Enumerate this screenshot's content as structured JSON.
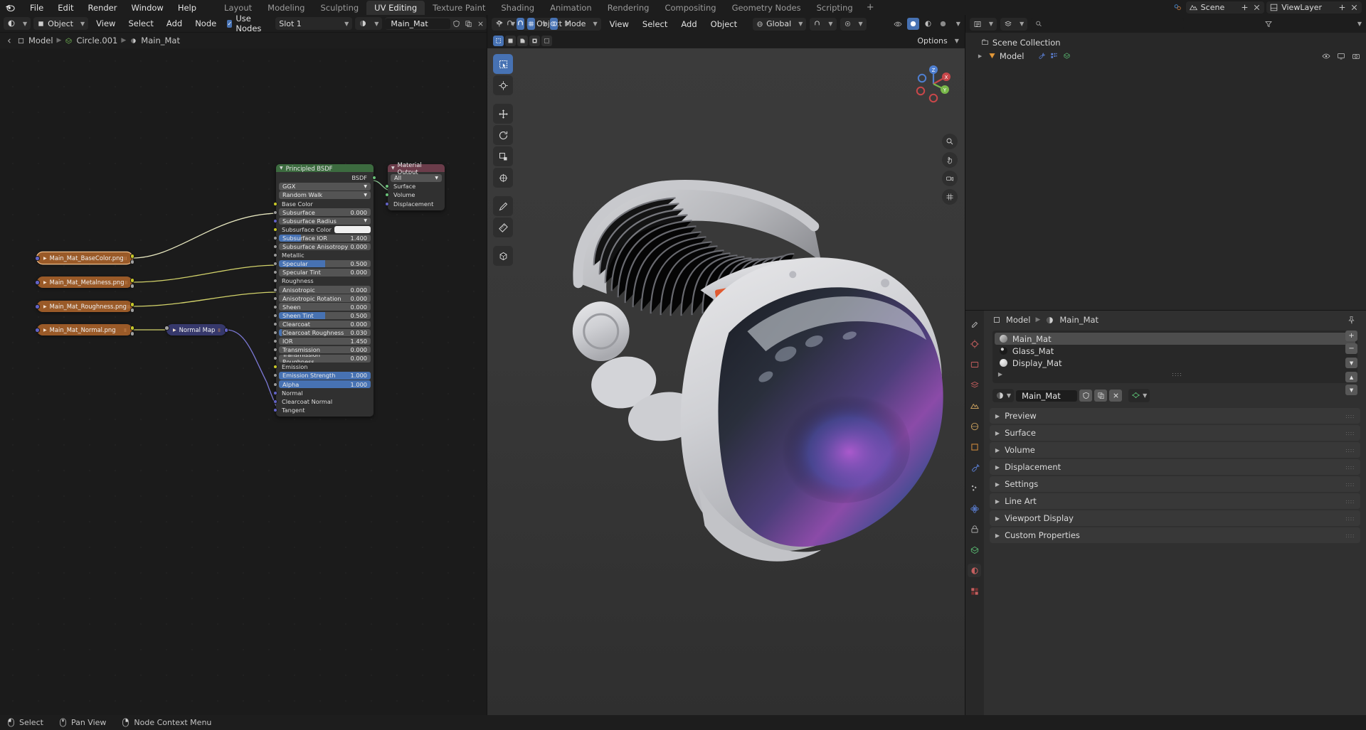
{
  "topbar": {
    "logo": "blender-logo",
    "menus": [
      "File",
      "Edit",
      "Render",
      "Window",
      "Help"
    ],
    "workspaces": [
      {
        "label": "Layout",
        "active": false
      },
      {
        "label": "Modeling",
        "active": false
      },
      {
        "label": "Sculpting",
        "active": false
      },
      {
        "label": "UV Editing",
        "active": true
      },
      {
        "label": "Texture Paint",
        "active": false
      },
      {
        "label": "Shading",
        "active": false
      },
      {
        "label": "Animation",
        "active": false
      },
      {
        "label": "Rendering",
        "active": false
      },
      {
        "label": "Compositing",
        "active": false
      },
      {
        "label": "Geometry Nodes",
        "active": false
      },
      {
        "label": "Scripting",
        "active": false
      }
    ],
    "add_workspace": "+",
    "scene_label": "Scene",
    "viewlayer_label": "ViewLayer"
  },
  "shader_editor": {
    "header": {
      "editor_type": "shader-editor-icon",
      "shader_type": "Object",
      "menus": [
        "View",
        "Select",
        "Add",
        "Node"
      ],
      "use_nodes_label": "Use Nodes",
      "use_nodes_checked": true,
      "slot": "Slot 1",
      "material": "Main_Mat"
    },
    "breadcrumb": [
      "Model",
      "Circle.001",
      "Main_Mat"
    ],
    "nodes": {
      "principled": {
        "title": "Principled BSDF",
        "header_color": "#3c6b3f",
        "output_socket": "BSDF",
        "distribution": "GGX",
        "subsurface_method": "Random Walk",
        "inputs": [
          {
            "label": "Base Color",
            "type": "socket",
            "sock": "yellow"
          },
          {
            "label": "Subsurface",
            "value": "0.000",
            "type": "slider",
            "fill": 0,
            "sock": "gray"
          },
          {
            "label": "Subsurface Radius",
            "type": "dropdown",
            "sock": "purple"
          },
          {
            "label": "Subsurface Color",
            "type": "color",
            "swatch": "#f0f0f0",
            "sock": "yellow"
          },
          {
            "label": "Subsurface IOR",
            "value": "1.400",
            "type": "slider",
            "fill": 24,
            "sock": "gray"
          },
          {
            "label": "Subsurface Anisotropy",
            "value": "0.000",
            "type": "slider",
            "fill": 0,
            "sock": "gray"
          },
          {
            "label": "Metallic",
            "type": "socket",
            "sock": "gray"
          },
          {
            "label": "Specular",
            "value": "0.500",
            "type": "slider",
            "fill": 50,
            "sock": "gray"
          },
          {
            "label": "Specular Tint",
            "value": "0.000",
            "type": "slider",
            "fill": 0,
            "sock": "gray"
          },
          {
            "label": "Roughness",
            "type": "socket",
            "sock": "gray"
          },
          {
            "label": "Anisotropic",
            "value": "0.000",
            "type": "slider",
            "fill": 0,
            "sock": "gray"
          },
          {
            "label": "Anisotropic Rotation",
            "value": "0.000",
            "type": "slider",
            "fill": 0,
            "sock": "gray"
          },
          {
            "label": "Sheen",
            "value": "0.000",
            "type": "slider",
            "fill": 0,
            "sock": "gray"
          },
          {
            "label": "Sheen Tint",
            "value": "0.500",
            "type": "slider",
            "fill": 50,
            "sock": "gray"
          },
          {
            "label": "Clearcoat",
            "value": "0.000",
            "type": "slider",
            "fill": 0,
            "sock": "gray"
          },
          {
            "label": "Clearcoat Roughness",
            "value": "0.030",
            "type": "slider",
            "fill": 3,
            "sock": "gray"
          },
          {
            "label": "IOR",
            "value": "1.450",
            "type": "slider",
            "fill": 0,
            "sock": "gray"
          },
          {
            "label": "Transmission",
            "value": "0.000",
            "type": "slider",
            "fill": 0,
            "sock": "gray"
          },
          {
            "label": "Transmission Roughness",
            "value": "0.000",
            "type": "slider",
            "fill": 0,
            "sock": "gray"
          },
          {
            "label": "Emission",
            "type": "socket",
            "sock": "yellow"
          },
          {
            "label": "Emission Strength",
            "value": "1.000",
            "type": "slider",
            "fill": 100,
            "sock": "gray"
          },
          {
            "label": "Alpha",
            "value": "1.000",
            "type": "slider",
            "fill": 100,
            "sock": "gray"
          },
          {
            "label": "Normal",
            "type": "socket",
            "sock": "purple"
          },
          {
            "label": "Clearcoat Normal",
            "type": "socket",
            "sock": "purple"
          },
          {
            "label": "Tangent",
            "type": "socket",
            "sock": "purple"
          }
        ]
      },
      "material_output": {
        "title": "Material Output",
        "header_color": "#6b3c4a",
        "target": "All",
        "inputs": [
          "Surface",
          "Volume",
          "Displacement"
        ]
      },
      "normal_map": {
        "title": "Normal Map",
        "header_color": "#36386b"
      },
      "textures": [
        {
          "name": "Main_Mat_BaseColor.png",
          "selected": true
        },
        {
          "name": "Main_Mat_Metalness.png",
          "selected": false
        },
        {
          "name": "Main_Mat_Roughness.png",
          "selected": false
        },
        {
          "name": "Main_Mat_Normal.png",
          "selected": false
        }
      ]
    }
  },
  "viewport": {
    "header": {
      "mode": "Object Mode",
      "menus": [
        "View",
        "Select",
        "Add",
        "Object"
      ],
      "transform_orientation": "Global",
      "options_label": "Options"
    },
    "tools": [
      {
        "name": "tweak-tool",
        "icon": "cursor-box",
        "active": true
      },
      {
        "name": "cursor-tool",
        "icon": "cursor-crosshair",
        "active": false
      },
      {
        "name": "move-tool",
        "icon": "move-arrows",
        "active": false
      },
      {
        "name": "rotate-tool",
        "icon": "rotate",
        "active": false
      },
      {
        "name": "scale-tool",
        "icon": "scale",
        "active": false
      },
      {
        "name": "transform-tool",
        "icon": "transform",
        "active": false
      },
      {
        "name": "annotate-tool",
        "icon": "pencil",
        "active": false
      },
      {
        "name": "measure-tool",
        "icon": "ruler",
        "active": false
      },
      {
        "name": "add-cube-tool",
        "icon": "add-cube",
        "active": false
      }
    ],
    "gizmo_axes": [
      "X",
      "Y",
      "Z"
    ],
    "nav_buttons": [
      "zoom-icon",
      "pan-hand-icon",
      "camera-icon",
      "grid-icon"
    ]
  },
  "outliner": {
    "display_mode": "View Layer",
    "search_placeholder": "",
    "scene_collection": "Scene Collection",
    "items": [
      {
        "label": "Model",
        "icons": [
          "wrench-icon",
          "modifier-icon",
          "mesh-data-icon"
        ],
        "vis": [
          "eye-icon",
          "screen-icon",
          "camera-icon"
        ]
      }
    ]
  },
  "properties": {
    "breadcrumb": [
      "Model",
      "Main_Mat"
    ],
    "material_slots": [
      {
        "name": "Main_Mat",
        "selected": true,
        "color": "#9a9a9a"
      },
      {
        "name": "Glass_Mat",
        "selected": false,
        "color": "#1b1b1b"
      },
      {
        "name": "Display_Mat",
        "selected": false,
        "color": "#c8c8c8"
      }
    ],
    "slot_buttons": [
      "+",
      "-",
      "v",
      "up",
      "down"
    ],
    "datablock_name": "Main_Mat",
    "datablock_buttons": [
      "shield-icon",
      "copy-icon",
      "close-icon"
    ],
    "panels": [
      "Preview",
      "Surface",
      "Volume",
      "Displacement",
      "Settings",
      "Line Art",
      "Viewport Display",
      "Custom Properties"
    ],
    "tabs": [
      "tool-icon",
      "render-icon",
      "output-icon",
      "viewlayer-icon",
      "scene-icon",
      "world-icon",
      "object-icon",
      "modifier-icon",
      "particles-icon",
      "physics-icon",
      "constraint-icon",
      "data-icon",
      "material-icon",
      "texture-icon"
    ]
  },
  "statusbar": {
    "items": [
      {
        "icon": "mouse-left-icon",
        "label": "Select"
      },
      {
        "icon": "mouse-middle-icon",
        "label": "Pan View"
      },
      {
        "icon": "mouse-right-icon",
        "label": "Node Context Menu"
      }
    ]
  },
  "colors": {
    "accent_blue": "#4772b3",
    "node_tex_brown": "#9a5a28",
    "bsdf_green": "#3c6b3f",
    "output_maroon": "#6b3c4a",
    "normalmap_blue": "#36386b",
    "bg_dark": "#1d1d1d",
    "panel_bg": "#303030"
  }
}
